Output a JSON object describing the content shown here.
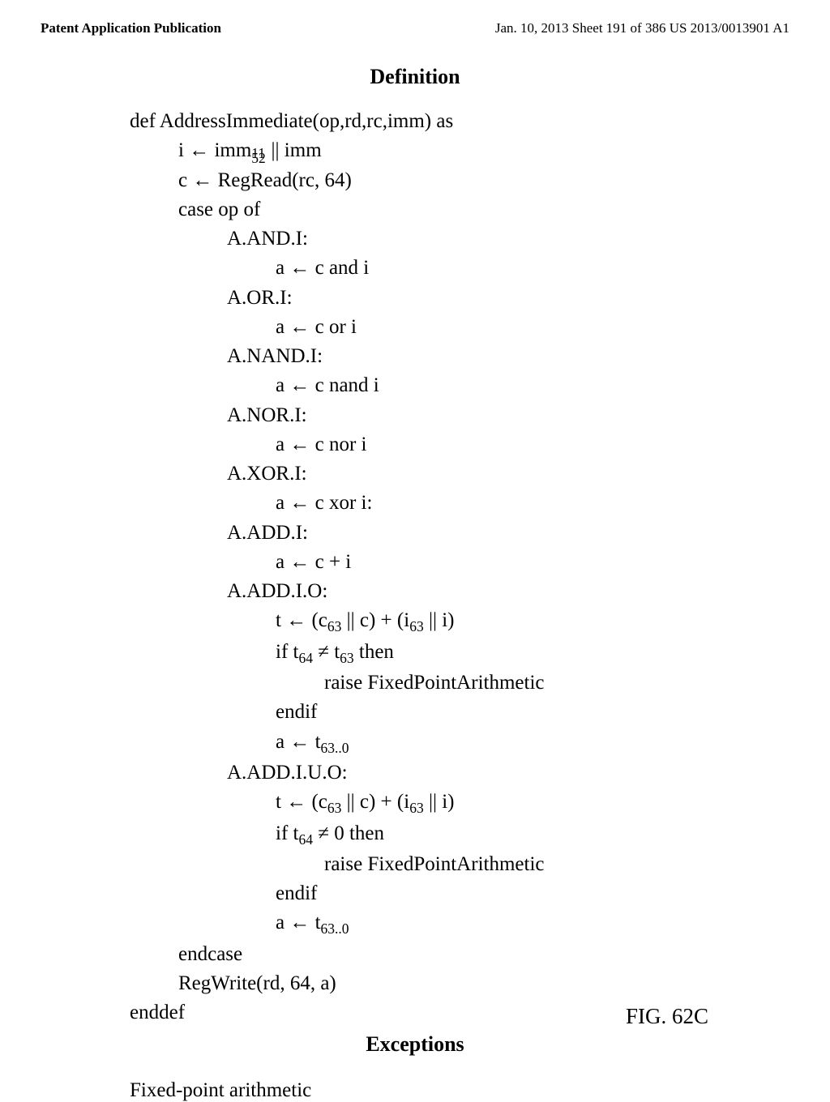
{
  "header": {
    "left": "Patent Application Publication",
    "right": "Jan. 10, 2013  Sheet 191 of 386   US 2013/0013901 A1"
  },
  "definition": {
    "title": "Definition",
    "lines": {
      "def_sig": "def AddressImmediate(op,rd,rc,imm) as",
      "l_i_pre": "i ← imm",
      "l_i_sup": "52",
      "l_i_sub": "11",
      "l_i_post": " || imm",
      "l_c": "c ← RegRead(rc, 64)",
      "l_case": "case op of",
      "l_and": "A.AND.I:",
      "l_and_body": "a ← c and i",
      "l_or": "A.OR.I:",
      "l_or_body": "a ← c or i",
      "l_nand": "A.NAND.I:",
      "l_nand_body": "a ← c nand i",
      "l_nor": "A.NOR.I:",
      "l_nor_body": "a ← c nor i",
      "l_xor": "A.XOR.I:",
      "l_xor_body": "a ← c xor i:",
      "l_add": "A.ADD.I:",
      "l_add_body": "a ← c + i",
      "l_addio": "A.ADD.I.O:",
      "l_addio_t_pre": "t ← (c",
      "l_addio_t_s1": "63",
      "l_addio_t_mid1": " || c) + (i",
      "l_addio_t_s2": "63",
      "l_addio_t_post": " || i)",
      "l_addio_if_pre": "if t",
      "l_addio_if_s1": "64",
      "l_addio_if_mid": " ≠ t",
      "l_addio_if_s2": "63",
      "l_addio_if_post": " then",
      "l_addio_raise": "raise FixedPointArithmetic",
      "l_addio_endif": "endif",
      "l_addio_a_pre": "a ← t",
      "l_addio_a_sub": "63..0",
      "l_addiuo": "A.ADD.I.U.O:",
      "l_addiuo_t_pre": "t ← (c",
      "l_addiuo_t_s1": "63",
      "l_addiuo_t_mid1": " || c) + (i",
      "l_addiuo_t_s2": "63",
      "l_addiuo_t_post": " || i)",
      "l_addiuo_if_pre": "if t",
      "l_addiuo_if_s1": "64",
      "l_addiuo_if_post": " ≠ 0 then",
      "l_addiuo_raise": "raise FixedPointArithmetic",
      "l_addiuo_endif": "endif",
      "l_addiuo_a_pre": "a ← t",
      "l_addiuo_a_sub": "63..0",
      "l_endcase": "endcase",
      "l_regwrite": "RegWrite(rd, 64, a)",
      "l_enddef": "enddef"
    }
  },
  "exceptions": {
    "title": "Exceptions",
    "body": "Fixed-point arithmetic"
  },
  "figure": {
    "label": "FIG. 62C"
  }
}
